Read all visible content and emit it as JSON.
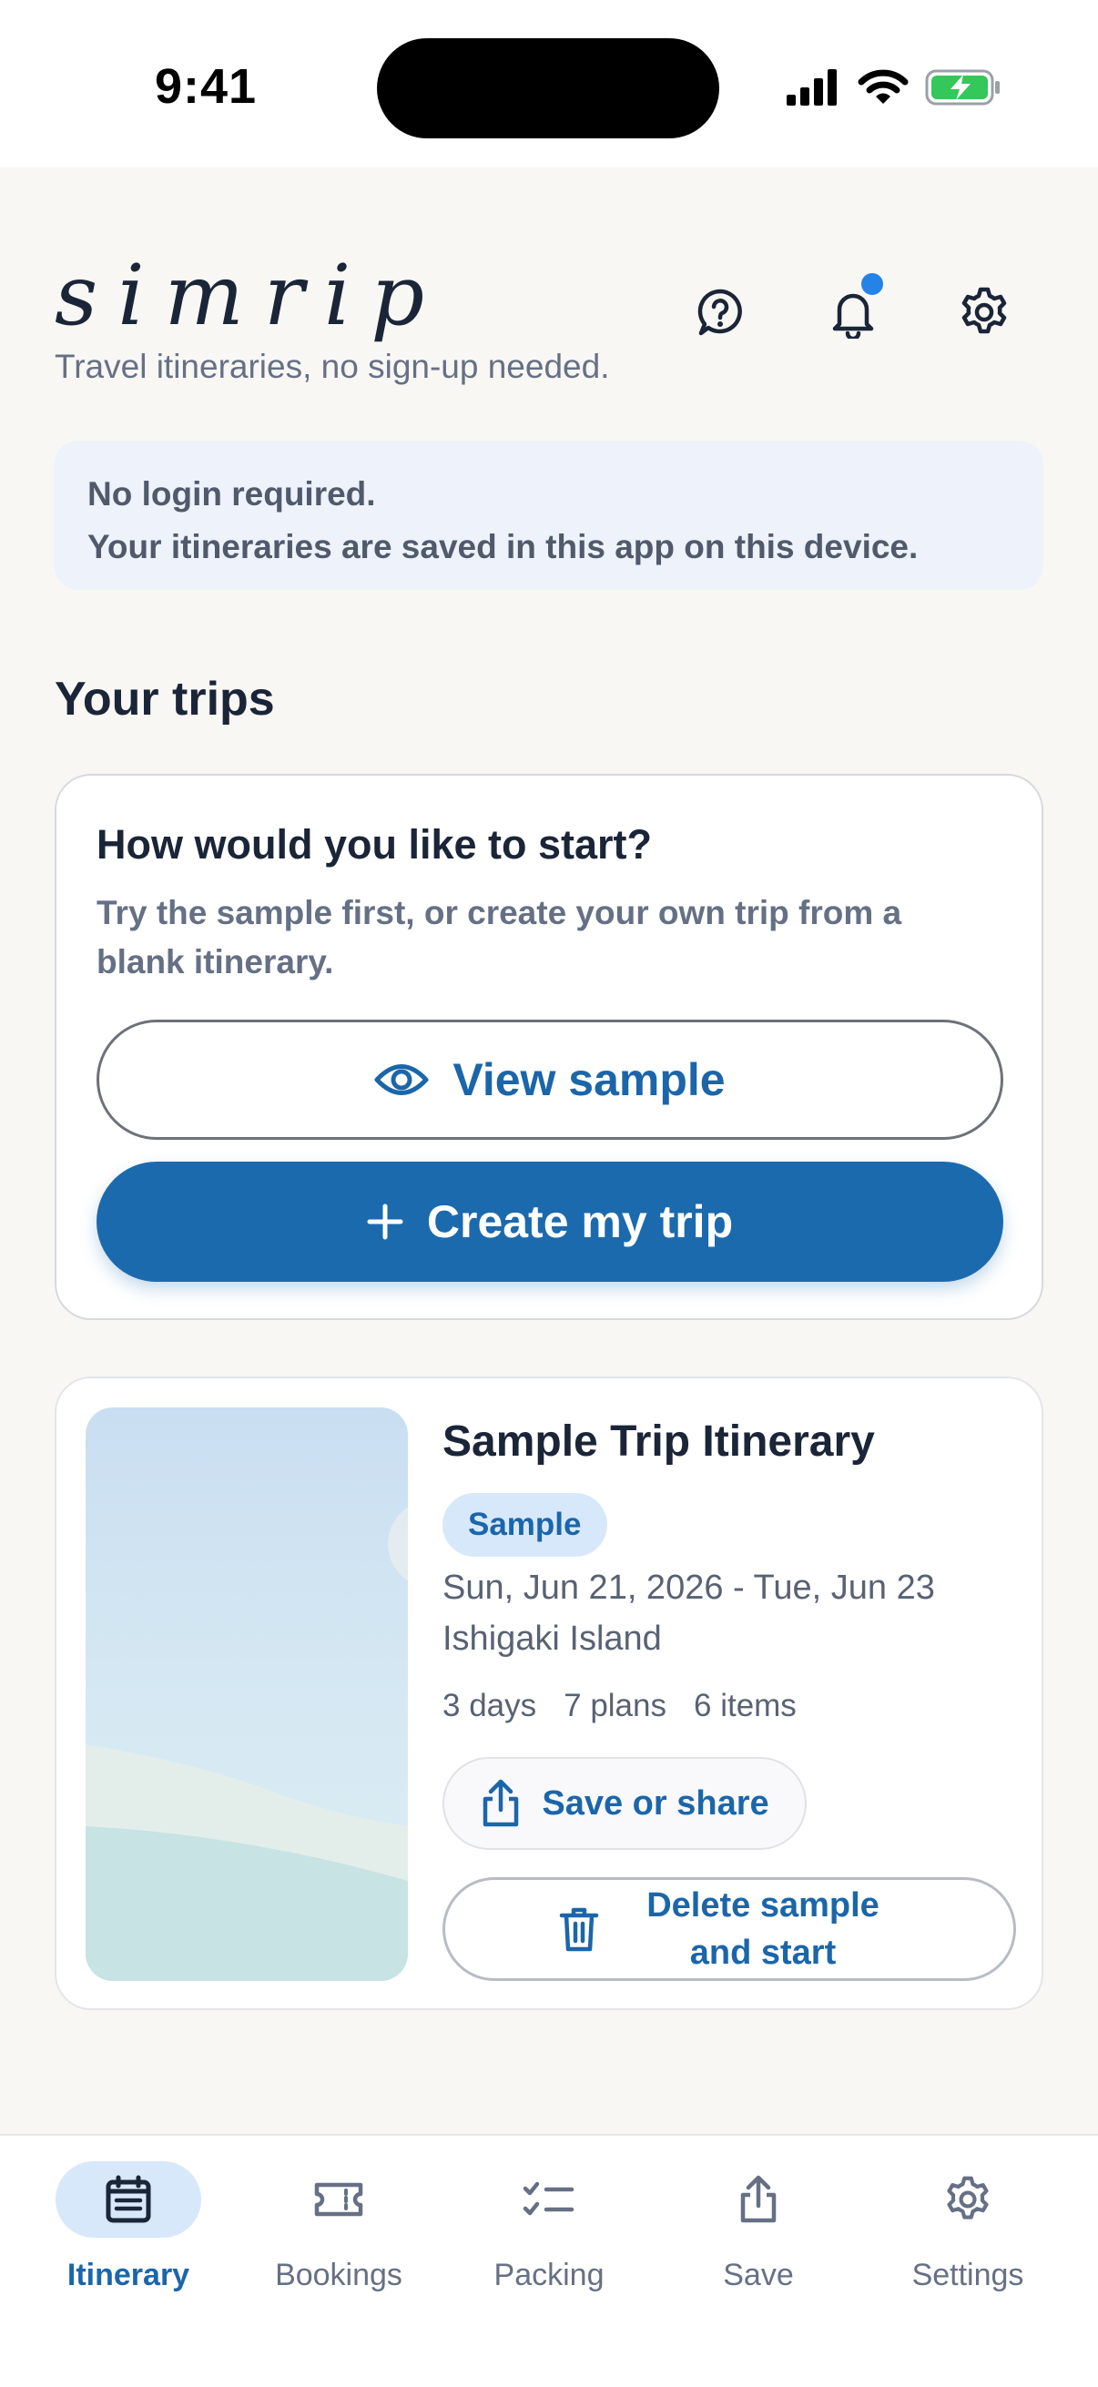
{
  "status_bar": {
    "time": "9:41"
  },
  "header": {
    "brand": "simrip",
    "tagline": "Travel itineraries, no sign-up needed.",
    "icons": [
      "help-icon",
      "bell-icon",
      "gear-icon"
    ]
  },
  "notice": {
    "line1": "No login required.",
    "line2": "Your itineraries are saved in this app on this device."
  },
  "section_title": "Your trips",
  "start_card": {
    "title": "How would you like to start?",
    "description": "Try the sample first, or create your own trip from a blank itinerary.",
    "view_sample_label": "View sample",
    "create_trip_label": "Create my trip"
  },
  "trip": {
    "title": "Sample Trip Itinerary",
    "badge": "Sample",
    "dates": "Sun, Jun 21, 2026 - Tue, Jun 23",
    "location": "Ishigaki Island",
    "stats": {
      "days": "3 days",
      "plans": "7 plans",
      "items": "6 items"
    },
    "share_label": "Save or share",
    "delete_label_line1": "Delete sample",
    "delete_label_line2": "and start"
  },
  "tab_bar": {
    "active": "Itinerary",
    "tabs": [
      {
        "label": "Itinerary",
        "icon": "calendar-icon"
      },
      {
        "label": "Bookings",
        "icon": "ticket-icon"
      },
      {
        "label": "Packing",
        "icon": "checklist-icon"
      },
      {
        "label": "Save",
        "icon": "share-icon"
      },
      {
        "label": "Settings",
        "icon": "gear-icon"
      }
    ]
  },
  "colors": {
    "accent": "#1b6aae",
    "badge_bg": "#d8e8fb",
    "notice_bg": "#edf2fb",
    "notification_dot": "#2582e6"
  }
}
